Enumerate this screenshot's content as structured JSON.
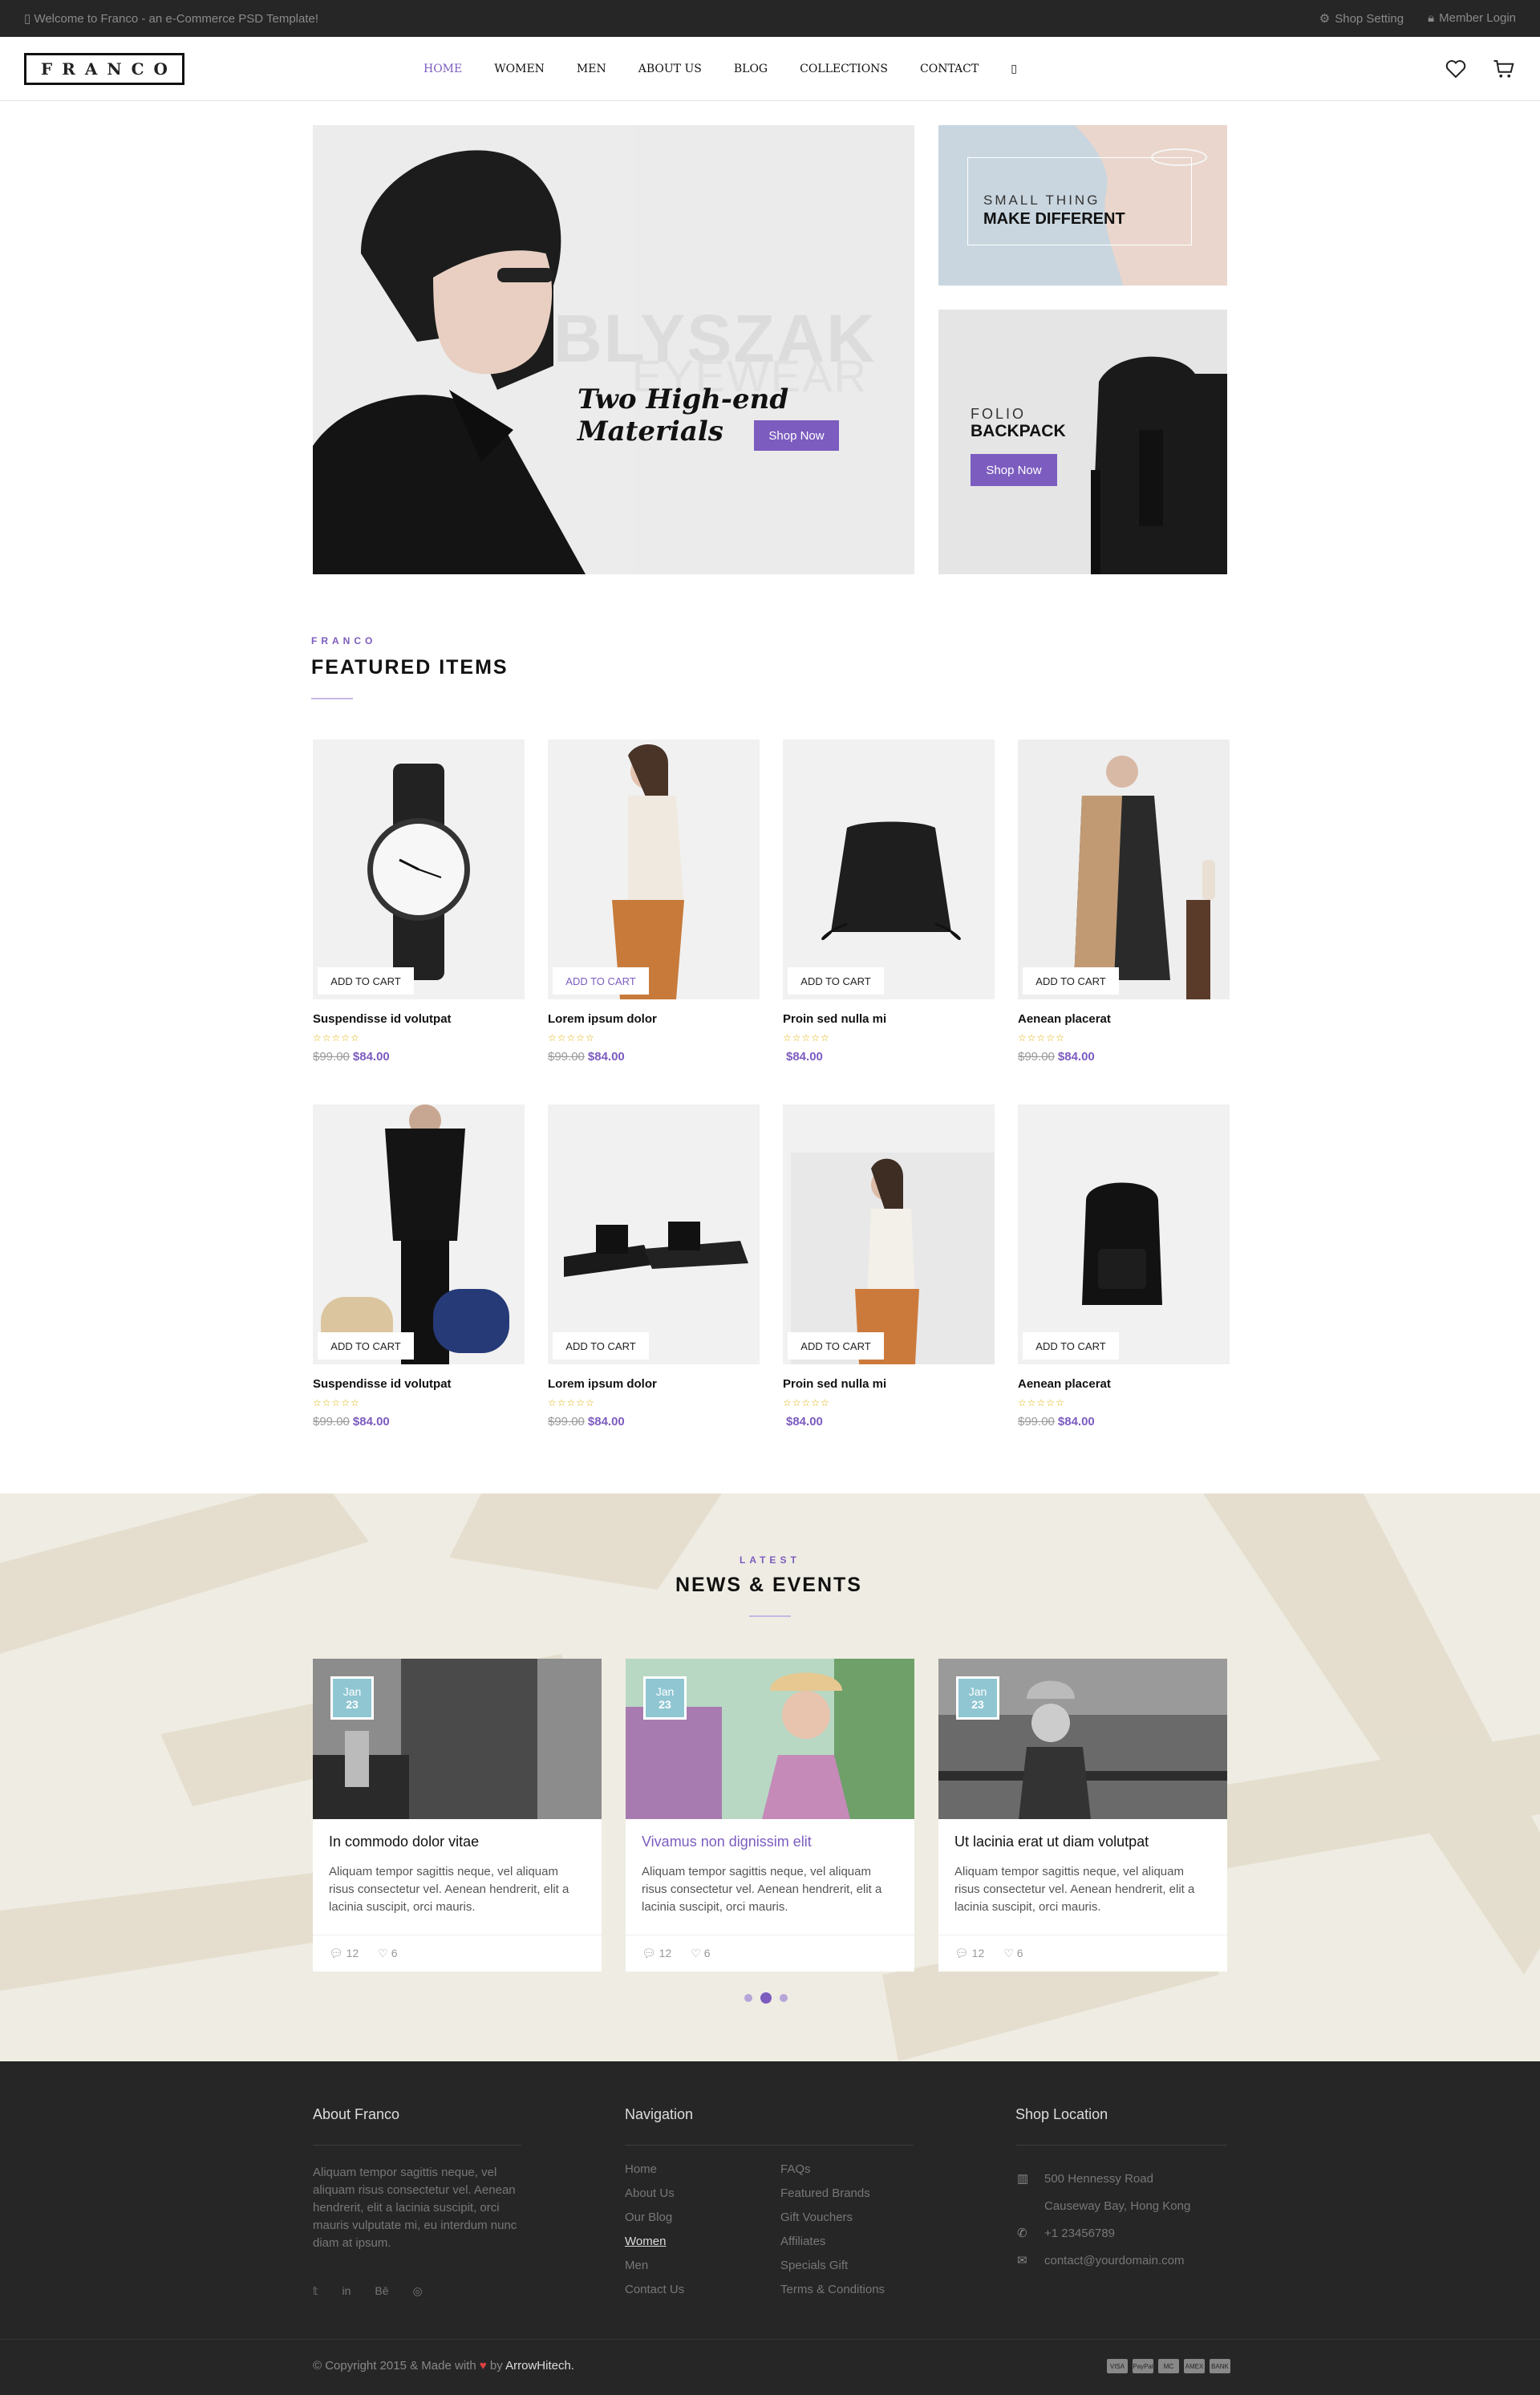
{
  "topbar": {
    "welcome": "Welcome to Franco - an e-Commerce PSD Template!",
    "shop_setting": "Shop Setting",
    "member_login": "Member Login"
  },
  "header": {
    "logo": "FRANCO",
    "nav": [
      "HOME",
      "WOMEN",
      "MEN",
      "ABOUT US",
      "BLOG",
      "COLLECTIONS",
      "CONTACT"
    ]
  },
  "hero": {
    "main_bg_word1": "BLYSZAK",
    "main_bg_word2": "EYEWEAR",
    "main_script": "Two High-end Materials",
    "main_button": "Shop Now",
    "side1_small": "SMALL THING",
    "side1_big": "MAKE DIFFERENT",
    "side2_small": "FOLIO",
    "side2_big": "BACKPACK",
    "side2_button": "Shop Now"
  },
  "featured": {
    "kicker": "FRANCO",
    "title": "FEATURED ITEMS",
    "add_to_cart": "ADD TO CART",
    "products": [
      {
        "name": "Suspendisse id volutpat",
        "stars": "☆☆☆☆☆",
        "old": "$99.00",
        "new": "$84.00"
      },
      {
        "name": "Lorem ipsum dolor",
        "stars": "☆☆☆☆☆",
        "old": "$99.00",
        "new": "$84.00"
      },
      {
        "name": "Proin sed nulla mi",
        "stars": "☆☆☆☆☆",
        "old": "",
        "new": "$84.00"
      },
      {
        "name": "Aenean placerat",
        "stars": "☆☆☆☆☆",
        "old": "$99.00",
        "new": "$84.00"
      },
      {
        "name": "Suspendisse id volutpat",
        "stars": "☆☆☆☆☆",
        "old": "$99.00",
        "new": "$84.00"
      },
      {
        "name": "Lorem ipsum dolor",
        "stars": "☆☆☆☆☆",
        "old": "$99.00",
        "new": "$84.00"
      },
      {
        "name": "Proin sed nulla mi",
        "stars": "☆☆☆☆☆",
        "old": "",
        "new": "$84.00"
      },
      {
        "name": "Aenean placerat",
        "stars": "☆☆☆☆☆",
        "old": "$99.00",
        "new": "$84.00"
      }
    ]
  },
  "news": {
    "kicker": "LATEST",
    "title": "NEWS & EVENTS",
    "cards": [
      {
        "month": "Jan",
        "day": "23",
        "title": "In commodo dolor vitae",
        "excerpt": "Aliquam tempor sagittis neque, vel aliquam risus consectetur vel. Aenean hendrerit, elit a lacinia suscipit, orci mauris.",
        "comments": "12",
        "likes": "6"
      },
      {
        "month": "Jan",
        "day": "23",
        "title": "Vivamus non dignissim elit",
        "excerpt": "Aliquam tempor sagittis neque, vel aliquam risus consectetur vel. Aenean hendrerit, elit a lacinia suscipit, orci mauris.",
        "comments": "12",
        "likes": "6"
      },
      {
        "month": "Jan",
        "day": "23",
        "title": "Ut lacinia erat ut diam volutpat",
        "excerpt": "Aliquam tempor sagittis neque, vel aliquam risus consectetur vel. Aenean hendrerit, elit a lacinia suscipit, orci mauris.",
        "comments": "12",
        "likes": "6"
      }
    ]
  },
  "footer": {
    "about_title": "About Franco",
    "about_text": "Aliquam tempor sagittis neque, vel aliquam risus consectetur vel. Aenean hendrerit, elit a lacinia suscipit, orci mauris vulputate mi, eu interdum nunc diam at ipsum.",
    "nav_title": "Navigation",
    "nav_col1": [
      "Home",
      "About Us",
      "Our Blog",
      "Women",
      "Men",
      "Contact Us"
    ],
    "nav_col2": [
      "FAQs",
      "Featured Brands",
      "Gift Vouchers",
      "Affiliates",
      "Specials Gift",
      "Terms & Conditions"
    ],
    "loc_title": "Shop Location",
    "address1": "500 Hennessy Road",
    "address2": "Causeway Bay, Hong Kong",
    "phone": "+1 23456789",
    "email": "contact@yourdomain.com",
    "copyright": "© Copyright 2015 & Made with",
    "by": "by",
    "author": "ArrowHitech.",
    "cards": [
      "VISA",
      "PayPal",
      "MC",
      "AMEX",
      "BANK"
    ]
  },
  "colors": {
    "accent": "#7c5cbf",
    "dark": "#262626",
    "date_badge": "#8fc6d2"
  }
}
